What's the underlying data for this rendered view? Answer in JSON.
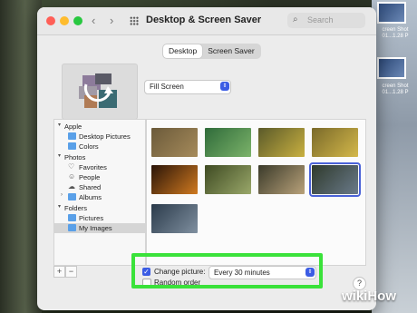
{
  "window": {
    "title": "Desktop & Screen Saver",
    "search_placeholder": "Search",
    "nav_back": "‹",
    "nav_forward": "›"
  },
  "tabs": [
    {
      "label": "Desktop",
      "selected": true
    },
    {
      "label": "Screen Saver",
      "selected": false
    }
  ],
  "fill_mode": {
    "value": "Fill Screen"
  },
  "sidebar": {
    "sections": [
      {
        "header": "Apple",
        "items": [
          {
            "label": "Desktop Pictures",
            "icon": "folder-icon"
          },
          {
            "label": "Colors",
            "icon": "colors-icon"
          }
        ]
      },
      {
        "header": "Photos",
        "items": [
          {
            "label": "Favorites",
            "icon": "heart-icon"
          },
          {
            "label": "People",
            "icon": "person-icon"
          },
          {
            "label": "Shared",
            "icon": "cloud-icon"
          },
          {
            "label": "Albums",
            "icon": "folder-icon"
          }
        ]
      },
      {
        "header": "Folders",
        "items": [
          {
            "label": "Pictures",
            "icon": "folder-icon"
          },
          {
            "label": "My Images",
            "icon": "folder-icon",
            "selected": true
          }
        ]
      }
    ],
    "add_label": "+",
    "remove_label": "−"
  },
  "thumbnails": [
    {
      "name": "deer-in-field",
      "colors": [
        "#6b5a3a",
        "#a68b5b"
      ]
    },
    {
      "name": "green-leaf",
      "colors": [
        "#2f6b3a",
        "#7cb36a"
      ]
    },
    {
      "name": "cactus-row",
      "colors": [
        "#5a5a2a",
        "#c9b040"
      ]
    },
    {
      "name": "pineapples",
      "colors": [
        "#7a6a2a",
        "#d4b84a"
      ]
    },
    {
      "name": "fireplace",
      "colors": [
        "#2a1408",
        "#d07a20"
      ]
    },
    {
      "name": "grass-blades",
      "colors": [
        "#3e4a22",
        "#9aa86a"
      ]
    },
    {
      "name": "mountain-stream",
      "colors": [
        "#3a3a2a",
        "#b9a27a"
      ]
    },
    {
      "name": "waterfall-cliff",
      "colors": [
        "#2f3a2c",
        "#6a7a8a"
      ],
      "selected": true
    },
    {
      "name": "coastal-mountains",
      "colors": [
        "#2a3a4a",
        "#8090a0"
      ]
    }
  ],
  "change_picture": {
    "label": "Change picture:",
    "checked": true,
    "interval": "Every 30 minutes"
  },
  "random_order": {
    "label": "Random order",
    "checked": false
  },
  "help_label": "?",
  "desktop": {
    "right_labels": [
      "creen Shot",
      "01...1.28 P",
      "creen Shot",
      "01...1.28 P"
    ]
  },
  "watermark": "wikiHow",
  "colors": {
    "accent": "#3b5ce4",
    "highlight": "#3ae23a"
  }
}
